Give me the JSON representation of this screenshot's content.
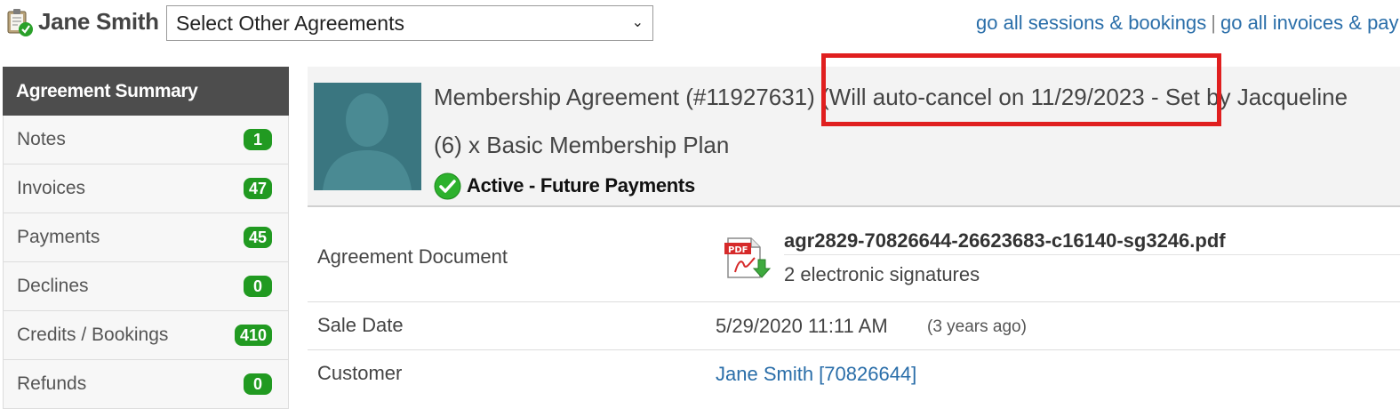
{
  "header": {
    "customer_name": "Jane Smith",
    "agreement_select": {
      "selected": "Select Other Agreements"
    },
    "links": [
      {
        "label": "go all sessions & bookings"
      },
      {
        "label": "go all invoices & payments"
      }
    ],
    "link_separator": "|"
  },
  "sidebar": {
    "title": "Agreement Summary",
    "items": [
      {
        "label": "Notes",
        "count": "1"
      },
      {
        "label": "Invoices",
        "count": "47"
      },
      {
        "label": "Payments",
        "count": "45"
      },
      {
        "label": "Declines",
        "count": "0"
      },
      {
        "label": "Credits / Bookings",
        "count": "410"
      },
      {
        "label": "Refunds",
        "count": "0"
      }
    ]
  },
  "agreement": {
    "title": "Membership Agreement (#11927631) (Will auto-cancel on 11/29/2023 - Set by Jacqueline",
    "plan": "(6) x Basic Membership Plan",
    "status": "Active - Future Payments"
  },
  "details": {
    "document": {
      "label": "Agreement Document",
      "file_name": "agr2829-70826644-26623683-c16140-sg3246.pdf",
      "signatures": "2 electronic signatures"
    },
    "sale_date": {
      "label": "Sale Date",
      "value": "5/29/2020 11:11 AM",
      "relative": "(3 years ago)"
    },
    "customer": {
      "label": "Customer",
      "value": "Jane Smith [70826644]"
    }
  },
  "colors": {
    "badge_green": "#219a21",
    "sidebar_header": "#4d4d4d",
    "link_blue": "#2a6ea9",
    "highlight_red": "#e01f1f"
  },
  "icons": [
    "clipboard-check-icon",
    "chevron-down-icon",
    "avatar-silhouette-icon",
    "check-circle-icon",
    "pdf-file-icon"
  ]
}
